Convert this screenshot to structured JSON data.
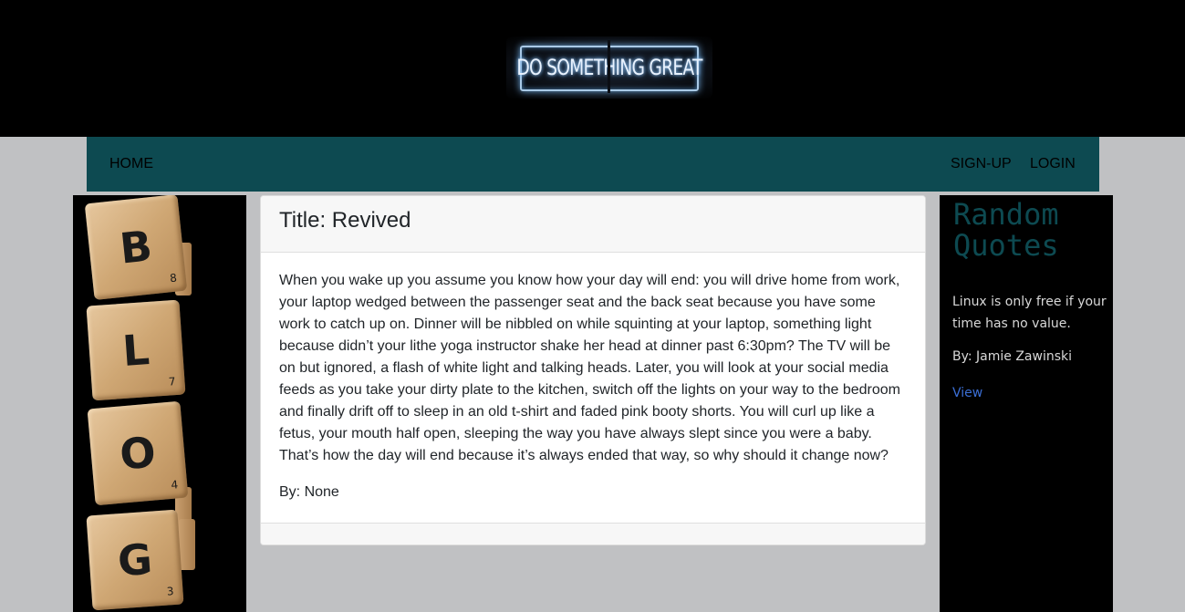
{
  "header": {
    "logo_text": "DO SOMETHING GREAT"
  },
  "nav": {
    "home": "HOME",
    "signup": "SIGN-UP",
    "login": "LOGIN"
  },
  "sidebar_left": {
    "tiles": [
      {
        "letter": "B",
        "number": "8"
      },
      {
        "letter": "L",
        "number": "7"
      },
      {
        "letter": "O",
        "number": "4"
      },
      {
        "letter": "G",
        "number": "3"
      }
    ]
  },
  "post": {
    "title": "Title: Revived",
    "body": "When you wake up you assume you know how your day will end: you will drive home from work, your laptop wedged between the passenger seat and the back seat because you have some work to catch up on. Dinner will be nibbled on while squinting at your laptop, something light because didn’t your lithe yoga instructor shake her head at dinner past 6:30pm? The TV will be on but ignored, a flash of white light and talking heads. Later, you will look at your social media feeds as you take your dirty plate to the kitchen, switch off the lights on your way to the bedroom and finally drift off to sleep in an old t-shirt and faded pink booty shorts. You will curl up like a fetus, your mouth half open, sleeping the way you have always slept since you were a baby. That’s how the day will end because it’s always ended that way, so why should it change now?",
    "author": "By: None"
  },
  "sidebar_right": {
    "title": "Random Quotes",
    "quote": "Linux is only free if your time has no value.",
    "author": "By: Jamie Zawinski",
    "link": "View"
  },
  "colors": {
    "nav_bg": "#0d4a51",
    "page_bg": "#c0c1c3",
    "link": "#3b6fd6"
  }
}
